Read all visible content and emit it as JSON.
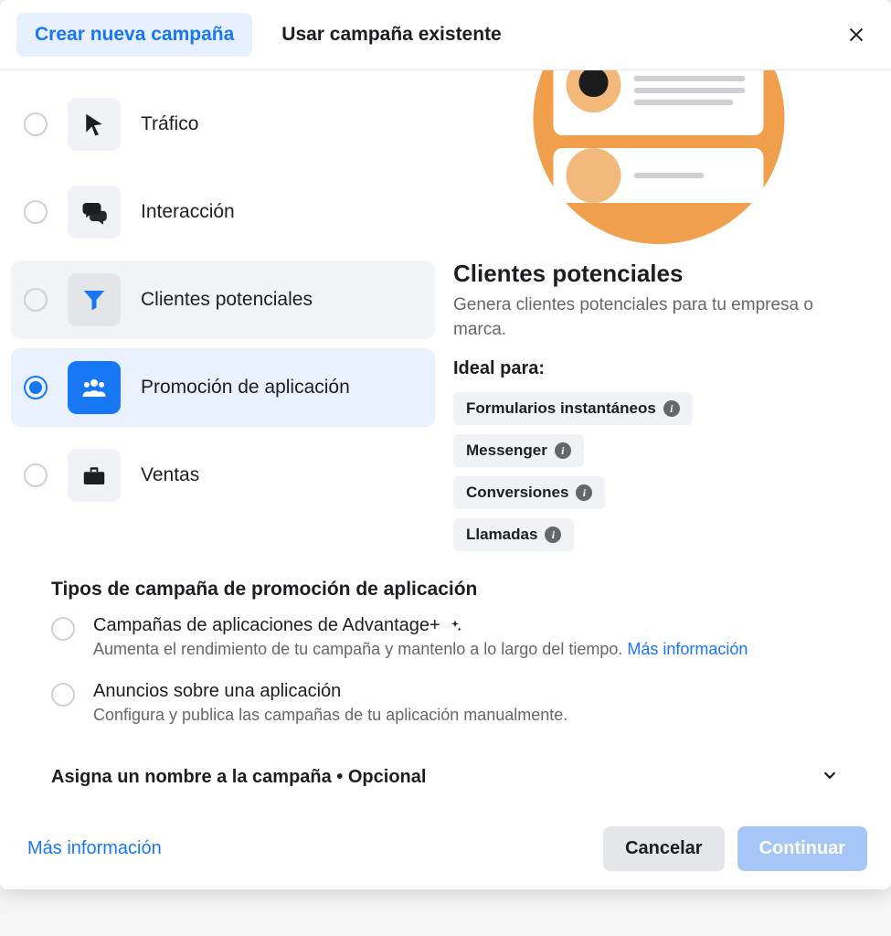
{
  "header": {
    "tabs": {
      "create": "Crear nueva campaña",
      "existing": "Usar campaña existente"
    }
  },
  "objectives": {
    "traffic": "Tráfico",
    "engagement": "Interacción",
    "leads": "Clientes potenciales",
    "app_promotion": "Promoción de aplicación",
    "sales": "Ventas"
  },
  "detail": {
    "title": "Clientes potenciales",
    "description": "Genera clientes potenciales para tu empresa o marca.",
    "ideal_for_title": "Ideal para:",
    "chips": {
      "instant_forms": "Formularios instantáneos",
      "messenger": "Messenger",
      "conversions": "Conversiones",
      "calls": "Llamadas"
    }
  },
  "types_section": {
    "title": "Tipos de campaña de promoción de aplicación",
    "advantage": {
      "title": "Campañas de aplicaciones de Advantage+",
      "desc": "Aumenta el rendimiento de tu campaña y mantenlo a lo largo del tiempo. ",
      "more": "Más información"
    },
    "manual": {
      "title": "Anuncios sobre una aplicación",
      "desc": "Configura y publica las campañas de tu aplicación manualmente."
    }
  },
  "name_row": {
    "title": "Asigna un nombre a la campaña • Opcional"
  },
  "footer": {
    "more_info": "Más información",
    "cancel": "Cancelar",
    "continue": "Continuar"
  }
}
